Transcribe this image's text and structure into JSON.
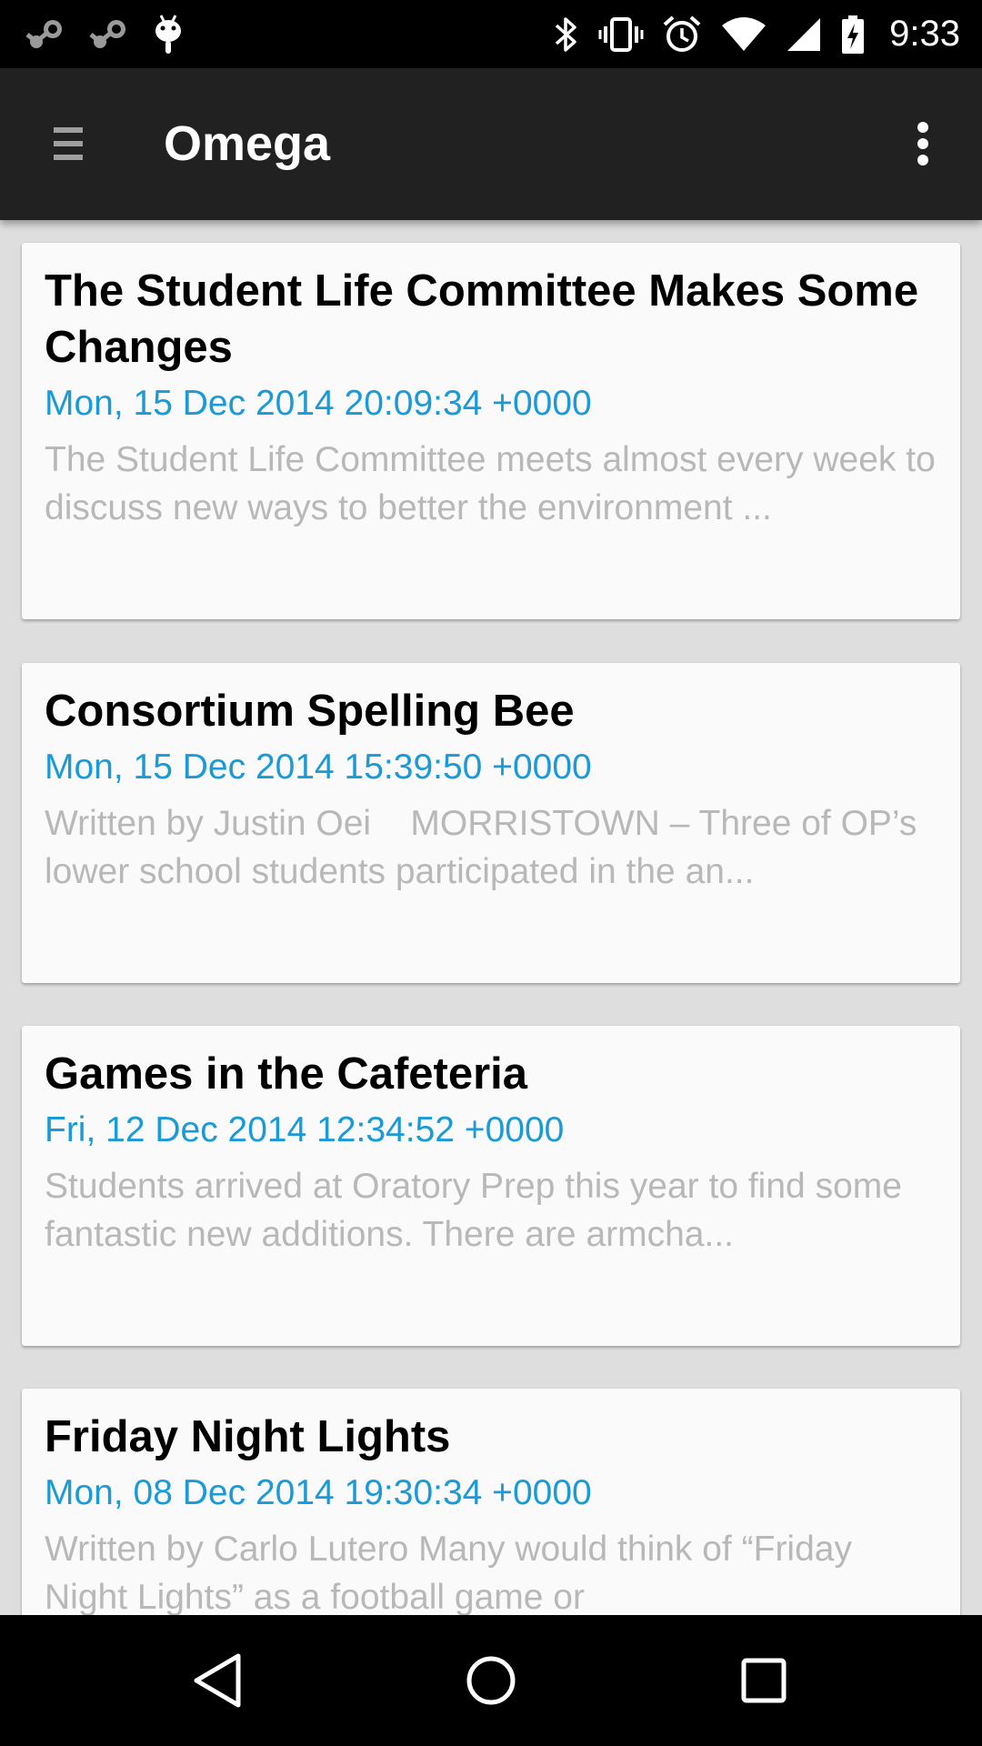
{
  "status_bar": {
    "time": "9:33",
    "left_icons": [
      "steam-notification-icon",
      "steam-notification-icon",
      "android-debug-icon"
    ],
    "right_icons": [
      "bluetooth-icon",
      "vibrate-icon",
      "alarm-icon",
      "wifi-icon",
      "cell-signal-icon",
      "battery-charging-icon"
    ]
  },
  "toolbar": {
    "title": "Omega",
    "menu_icon": "hamburger-menu-icon",
    "overflow_icon": "more-vert-icon"
  },
  "articles": [
    {
      "title": "The Student Life Committee Makes Some Changes",
      "date": "Mon, 15 Dec 2014 20:09:34 +0000",
      "excerpt": "The Student Life Committee meets almost every week to discuss new ways to better the environment ..."
    },
    {
      "title": "Consortium Spelling Bee",
      "date": "Mon, 15 Dec 2014 15:39:50 +0000",
      "excerpt": "Written by Justin Oei    MORRISTOWN – Three of OP’s lower school students participated in the an..."
    },
    {
      "title": "Games in the Cafeteria",
      "date": "Fri, 12 Dec 2014 12:34:52 +0000",
      "excerpt": "Students arrived at Oratory Prep this year to find some fantastic new additions. There are armcha..."
    },
    {
      "title": "Friday Night Lights",
      "date": "Mon, 08 Dec 2014 19:30:34 +0000",
      "excerpt": "Written by Carlo Lutero Many would think of “Friday Night Lights” as a football game or"
    }
  ],
  "nav_bar": {
    "icons": [
      "back-icon",
      "home-icon",
      "recents-icon"
    ]
  },
  "colors": {
    "accent": "#1a9ad6",
    "toolbar": "#212121",
    "background": "#dedede",
    "card": "#fafafa",
    "excerpt_text": "#b8b8b8"
  }
}
